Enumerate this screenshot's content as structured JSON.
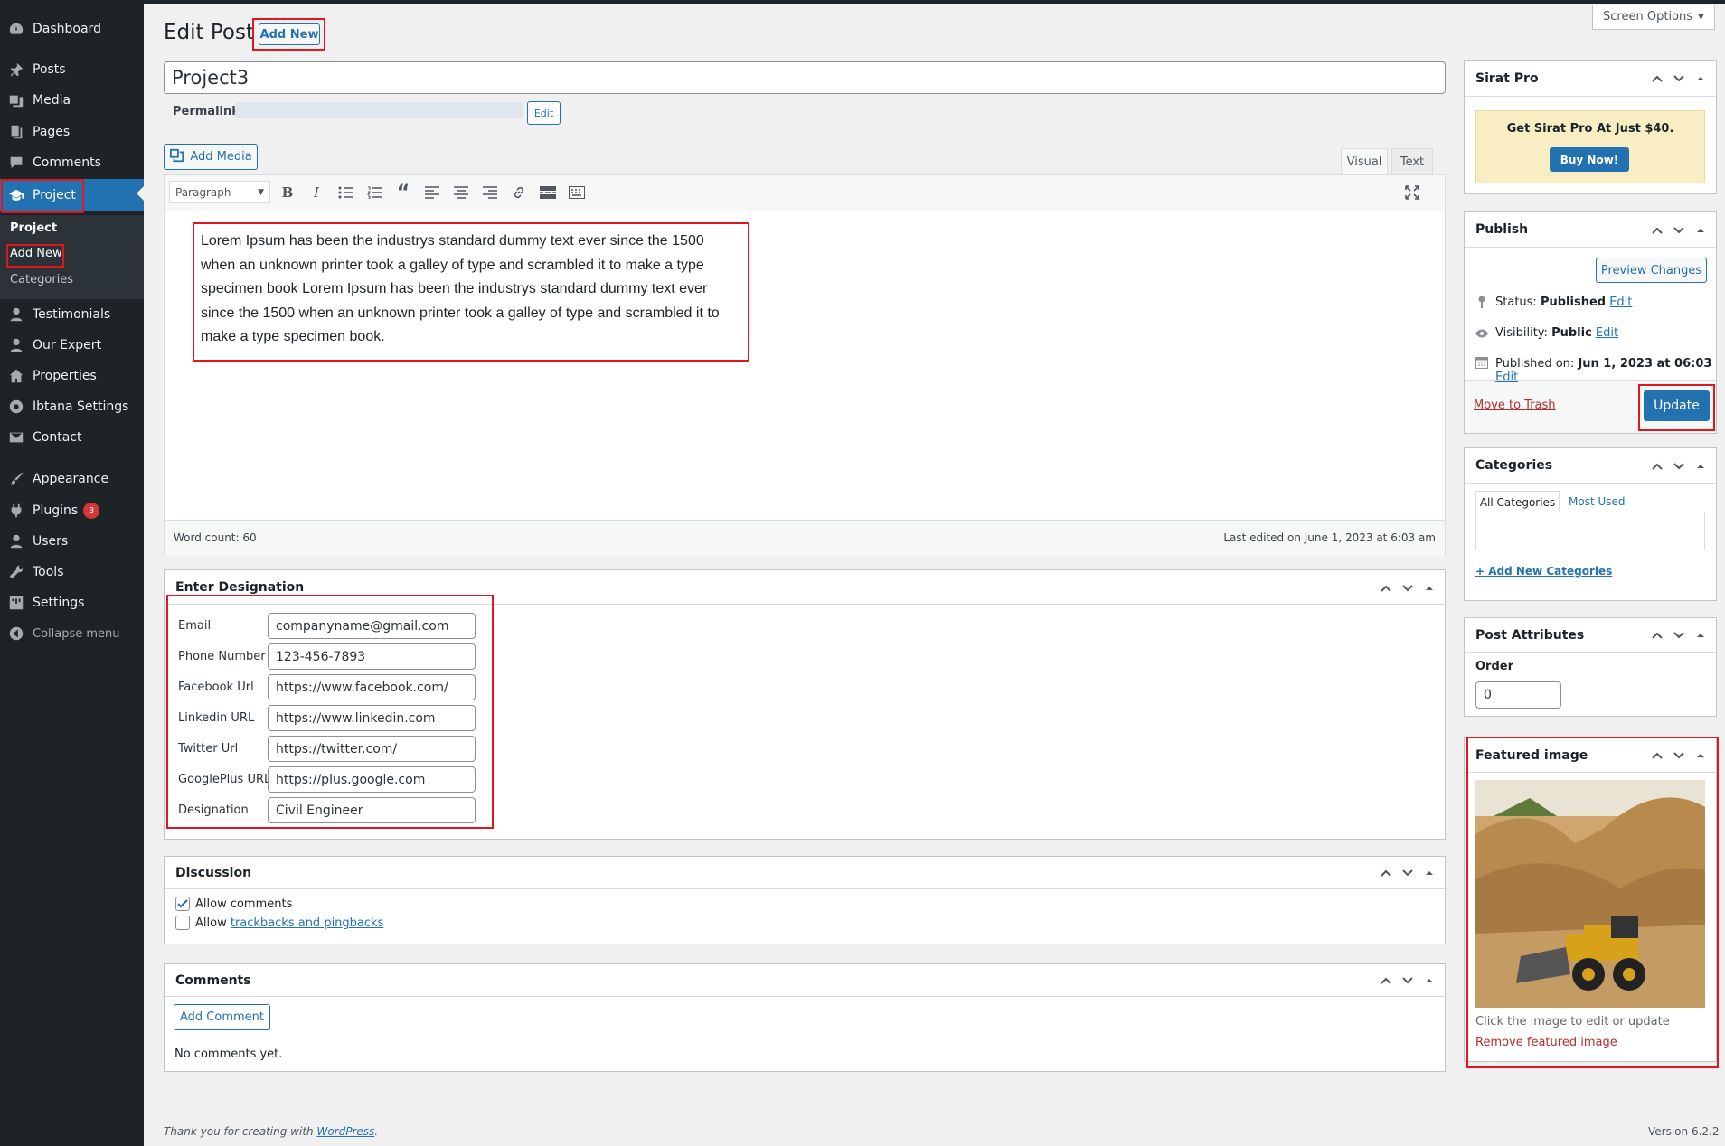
{
  "sidebar": {
    "items": [
      {
        "label": "Dashboard",
        "icon": "dashboard-icon"
      },
      {
        "label": "Posts",
        "icon": "pin-icon"
      },
      {
        "label": "Media",
        "icon": "media-icon"
      },
      {
        "label": "Pages",
        "icon": "pages-icon"
      },
      {
        "label": "Comments",
        "icon": "comments-icon"
      },
      {
        "label": "Project",
        "icon": "project-icon"
      },
      {
        "label": "Testimonials",
        "icon": "user-icon"
      },
      {
        "label": "Our Expert",
        "icon": "user-icon"
      },
      {
        "label": "Properties",
        "icon": "home-icon"
      },
      {
        "label": "Ibtana Settings",
        "icon": "settings-icon"
      },
      {
        "label": "Contact",
        "icon": "mail-icon"
      },
      {
        "label": "Appearance",
        "icon": "brush-icon"
      },
      {
        "label": "Plugins",
        "icon": "plugin-icon",
        "badge": "3"
      },
      {
        "label": "Users",
        "icon": "users-icon"
      },
      {
        "label": "Tools",
        "icon": "wrench-icon"
      },
      {
        "label": "Settings",
        "icon": "sliders-icon"
      },
      {
        "label": "Collapse menu",
        "icon": "collapse-icon"
      }
    ],
    "submenu": [
      "Project",
      "Add New",
      "Categories"
    ]
  },
  "header": {
    "title": "Edit Post",
    "add_new": "Add New",
    "screen_options": "Screen Options"
  },
  "post": {
    "title": "Project3",
    "permalink_label": "Permalink:",
    "permalink_edit": "Edit",
    "add_media": "Add Media",
    "tab_visual": "Visual",
    "tab_text": "Text",
    "format_select": "Paragraph",
    "content": "Lorem Ipsum has been the industrys standard dummy text ever since the 1500 when an unknown printer took a galley of type and scrambled it to make a type specimen book Lorem Ipsum has been the industrys standard dummy text ever since the 1500 when an unknown printer took a galley of type and scrambled it to make a type specimen book.",
    "word_count": "Word count: 60",
    "last_edited": "Last edited on June 1, 2023 at 6:03 am"
  },
  "designation": {
    "title": "Enter Designation",
    "fields": [
      {
        "label": "Email",
        "value": "companyname@gmail.com"
      },
      {
        "label": "Phone Number",
        "value": "123-456-7893"
      },
      {
        "label": "Facebook Url",
        "value": "https://www.facebook.com/"
      },
      {
        "label": "Linkedin URL",
        "value": "https://www.linkedin.com"
      },
      {
        "label": "Twitter Url",
        "value": "https://twitter.com/"
      },
      {
        "label": "GooglePlus URL",
        "value": "https://plus.google.com"
      },
      {
        "label": "Designation",
        "value": "Civil Engineer"
      }
    ]
  },
  "discussion": {
    "title": "Discussion",
    "allow_comments": "Allow comments",
    "allow_prefix": "Allow",
    "trackbacks": "trackbacks and pingbacks"
  },
  "comments": {
    "title": "Comments",
    "add_comment": "Add Comment",
    "empty": "No comments yet."
  },
  "sirat": {
    "title": "Sirat Pro",
    "promo": "Get Sirat Pro At Just $40.",
    "buy": "Buy Now!"
  },
  "publish": {
    "title": "Publish",
    "preview": "Preview Changes",
    "status_label": "Status:",
    "status_value": "Published",
    "visibility_label": "Visibility:",
    "visibility_value": "Public",
    "published_label": "Published on:",
    "published_value": "Jun 1, 2023 at 06:03",
    "edit": "Edit",
    "trash": "Move to Trash",
    "update": "Update"
  },
  "categories": {
    "title": "Categories",
    "tab_all": "All Categories",
    "tab_most": "Most Used",
    "add_new": "+ Add New Categories"
  },
  "attributes": {
    "title": "Post Attributes",
    "order_label": "Order",
    "order_value": "0"
  },
  "featured": {
    "title": "Featured image",
    "hint": "Click the image to edit or update",
    "remove": "Remove featured image"
  },
  "footer": {
    "thanks_prefix": "Thank you for creating with",
    "wordpress": "WordPress",
    "period": ".",
    "version": "Version 6.2.2"
  },
  "colors": {
    "accent": "#2271b1",
    "sidebar": "#1d2327",
    "highlight": "#e3161f"
  }
}
